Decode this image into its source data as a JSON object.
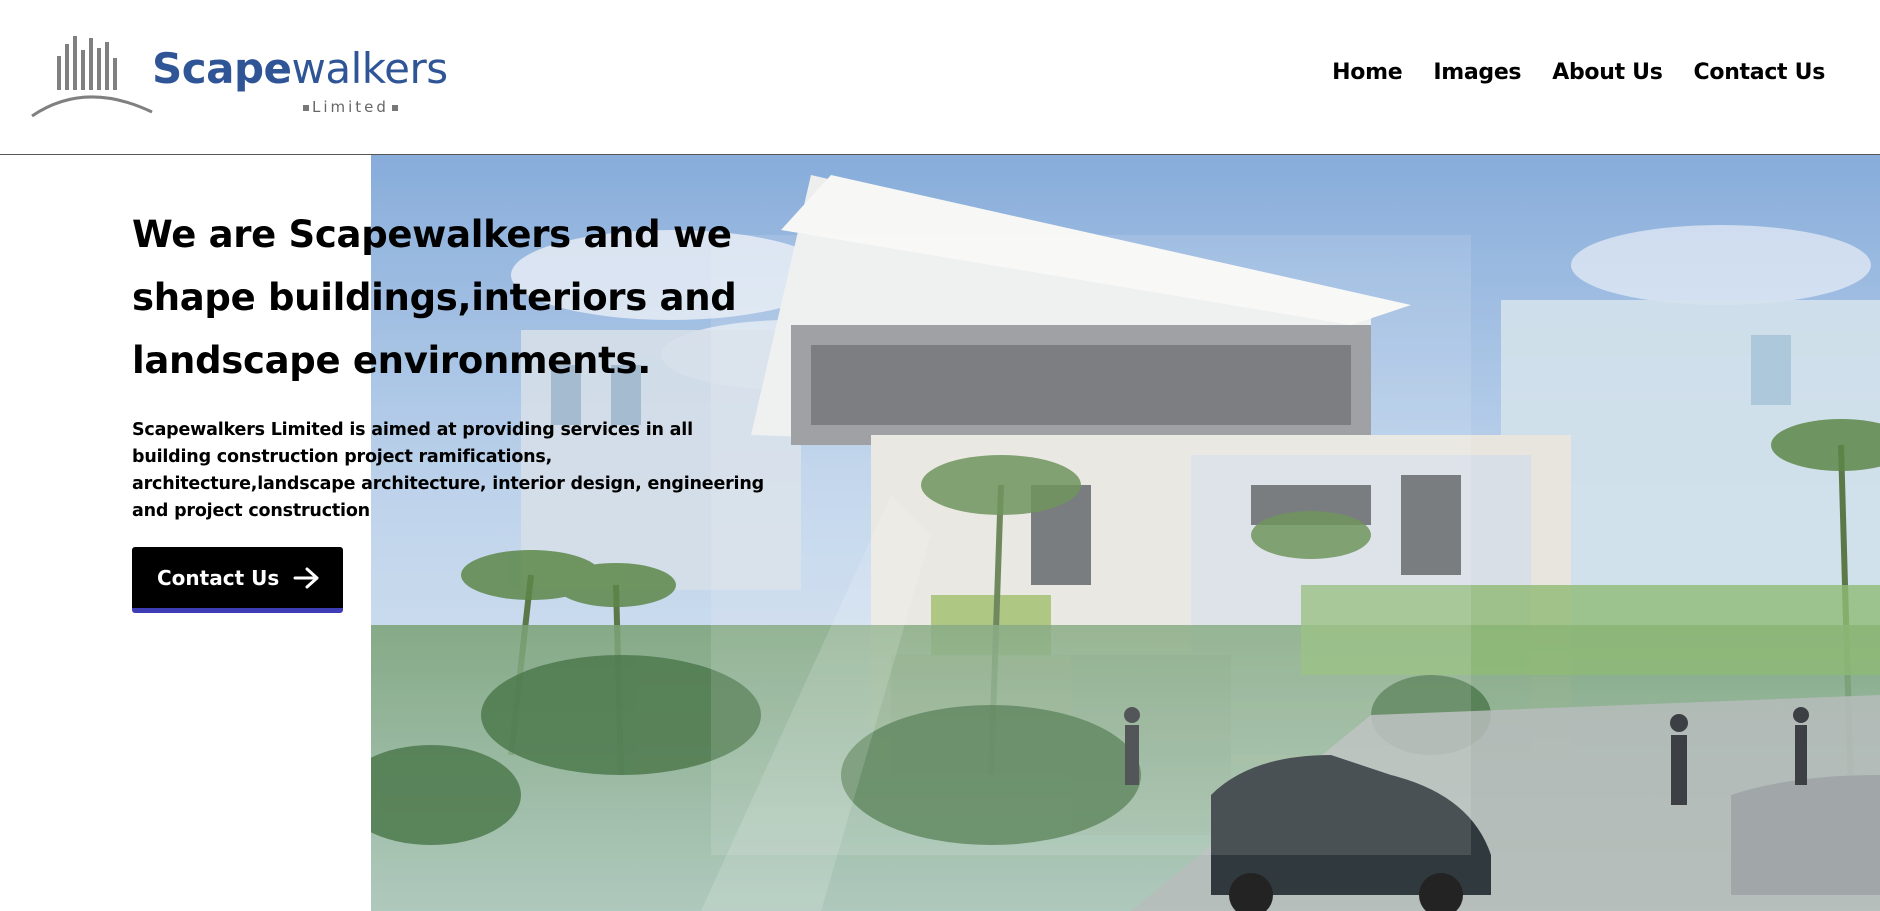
{
  "header": {
    "logo": {
      "name_bold": "Scape",
      "name_light": "walkers",
      "tagline": "Limited"
    },
    "nav": [
      {
        "label": "Home"
      },
      {
        "label": "Images"
      },
      {
        "label": "About Us"
      },
      {
        "label": "Contact Us"
      }
    ]
  },
  "hero": {
    "title": "We are Scapewalkers and we shape buildings,interiors and landscape environments.",
    "description": "Scapewalkers Limited is aimed at providing services in all building construction project ramifications, architecture,landscape architecture, interior design, engineering and project construction",
    "cta_label": "Contact Us",
    "cta_icon": "arrow-right-icon",
    "image": "building-rendering"
  },
  "colors": {
    "brand": "#2f5597",
    "cta_background": "#000000",
    "cta_underline": "#3f3db5"
  }
}
